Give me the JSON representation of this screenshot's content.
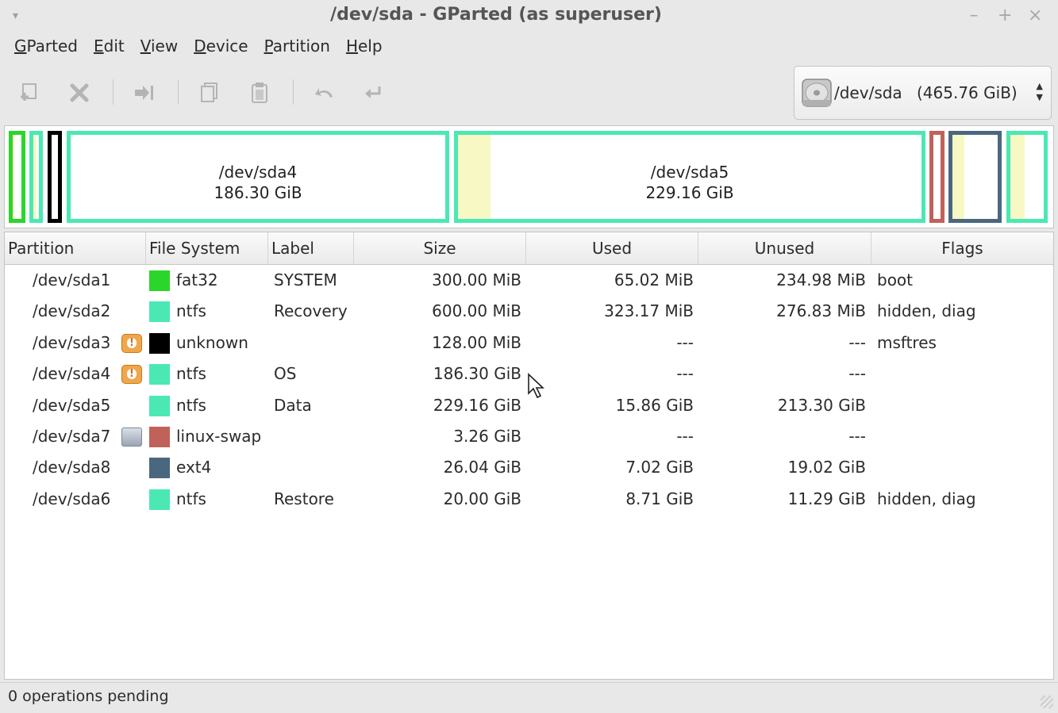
{
  "window": {
    "title": "/dev/sda - GParted (as superuser)",
    "menu_arrow": "▾",
    "buttons": [
      "–",
      "+",
      "×"
    ]
  },
  "menubar": [
    {
      "label": "GParted",
      "mnemonic": "G",
      "rest": "Parted"
    },
    {
      "label": "Edit",
      "mnemonic": "E",
      "rest": "dit"
    },
    {
      "label": "View",
      "mnemonic": "V",
      "rest": "iew"
    },
    {
      "label": "Device",
      "mnemonic": "D",
      "rest": "evice"
    },
    {
      "label": "Partition",
      "mnemonic": "P",
      "rest": "artition"
    },
    {
      "label": "Help",
      "mnemonic": "H",
      "rest": "elp"
    }
  ],
  "toolbar": {
    "icons": [
      "new-partition-icon",
      "delete-icon",
      "resize-move-icon",
      "copy-icon",
      "paste-icon",
      "undo-icon",
      "apply-icon"
    ]
  },
  "device_selector": {
    "device": "/dev/sda",
    "size": "(465.76 GiB)",
    "icon": "hard-disk-icon"
  },
  "disk_map": {
    "segments": [
      {
        "id": "sda1",
        "color": "#2bd52b",
        "used_fraction": 0.22
      },
      {
        "id": "sda2",
        "color": "#4be8b4",
        "used_fraction": 0.54
      },
      {
        "id": "sda3",
        "color": "#000000",
        "used_fraction": 0
      },
      {
        "id": "sda4",
        "color": "#4be8b4",
        "used_fraction": 0,
        "name": "/dev/sda4",
        "size": "186.30 GiB"
      },
      {
        "id": "sda5",
        "color": "#4be8b4",
        "used_fraction": 0.07,
        "name": "/dev/sda5",
        "size": "229.16 GiB"
      },
      {
        "id": "sda7",
        "color": "#c0625a",
        "used_fraction": 0
      },
      {
        "id": "sda8",
        "color": "#4a6780",
        "used_fraction": 0.27
      },
      {
        "id": "sda6",
        "color": "#4be8b4",
        "used_fraction": 0.44
      }
    ]
  },
  "table": {
    "headers": [
      "Partition",
      "File System",
      "Label",
      "Size",
      "Used",
      "Unused",
      "Flags"
    ],
    "rows": [
      {
        "partition": "/dev/sda1",
        "status_icon": "",
        "fs_color": "#2bd52b",
        "fs": "fat32",
        "label": "SYSTEM",
        "size": "300.00 MiB",
        "used": "65.02 MiB",
        "unused": "234.98 MiB",
        "flags": "boot"
      },
      {
        "partition": "/dev/sda2",
        "status_icon": "",
        "fs_color": "#4be8b4",
        "fs": "ntfs",
        "label": "Recovery",
        "size": "600.00 MiB",
        "used": "323.17 MiB",
        "unused": "276.83 MiB",
        "flags": "hidden, diag"
      },
      {
        "partition": "/dev/sda3",
        "status_icon": "warning-icon",
        "fs_color": "#000000",
        "fs": "unknown",
        "label": "",
        "size": "128.00 MiB",
        "used": "---",
        "unused": "---",
        "flags": "msftres"
      },
      {
        "partition": "/dev/sda4",
        "status_icon": "warning-icon",
        "fs_color": "#4be8b4",
        "fs": "ntfs",
        "label": "OS",
        "size": "186.30 GiB",
        "used": "---",
        "unused": "---",
        "flags": ""
      },
      {
        "partition": "/dev/sda5",
        "status_icon": "",
        "fs_color": "#4be8b4",
        "fs": "ntfs",
        "label": "Data",
        "size": "229.16 GiB",
        "used": "15.86 GiB",
        "unused": "213.30 GiB",
        "flags": ""
      },
      {
        "partition": "/dev/sda7",
        "status_icon": "lock-icon",
        "fs_color": "#c0625a",
        "fs": "linux-swap",
        "label": "",
        "size": "3.26 GiB",
        "used": "---",
        "unused": "---",
        "flags": ""
      },
      {
        "partition": "/dev/sda8",
        "status_icon": "",
        "fs_color": "#4a6780",
        "fs": "ext4",
        "label": "",
        "size": "26.04 GiB",
        "used": "7.02 GiB",
        "unused": "19.02 GiB",
        "flags": ""
      },
      {
        "partition": "/dev/sda6",
        "status_icon": "",
        "fs_color": "#4be8b4",
        "fs": "ntfs",
        "label": "Restore",
        "size": "20.00 GiB",
        "used": "8.71 GiB",
        "unused": "11.29 GiB",
        "flags": "hidden, diag"
      }
    ]
  },
  "statusbar": {
    "text": "0 operations pending"
  }
}
